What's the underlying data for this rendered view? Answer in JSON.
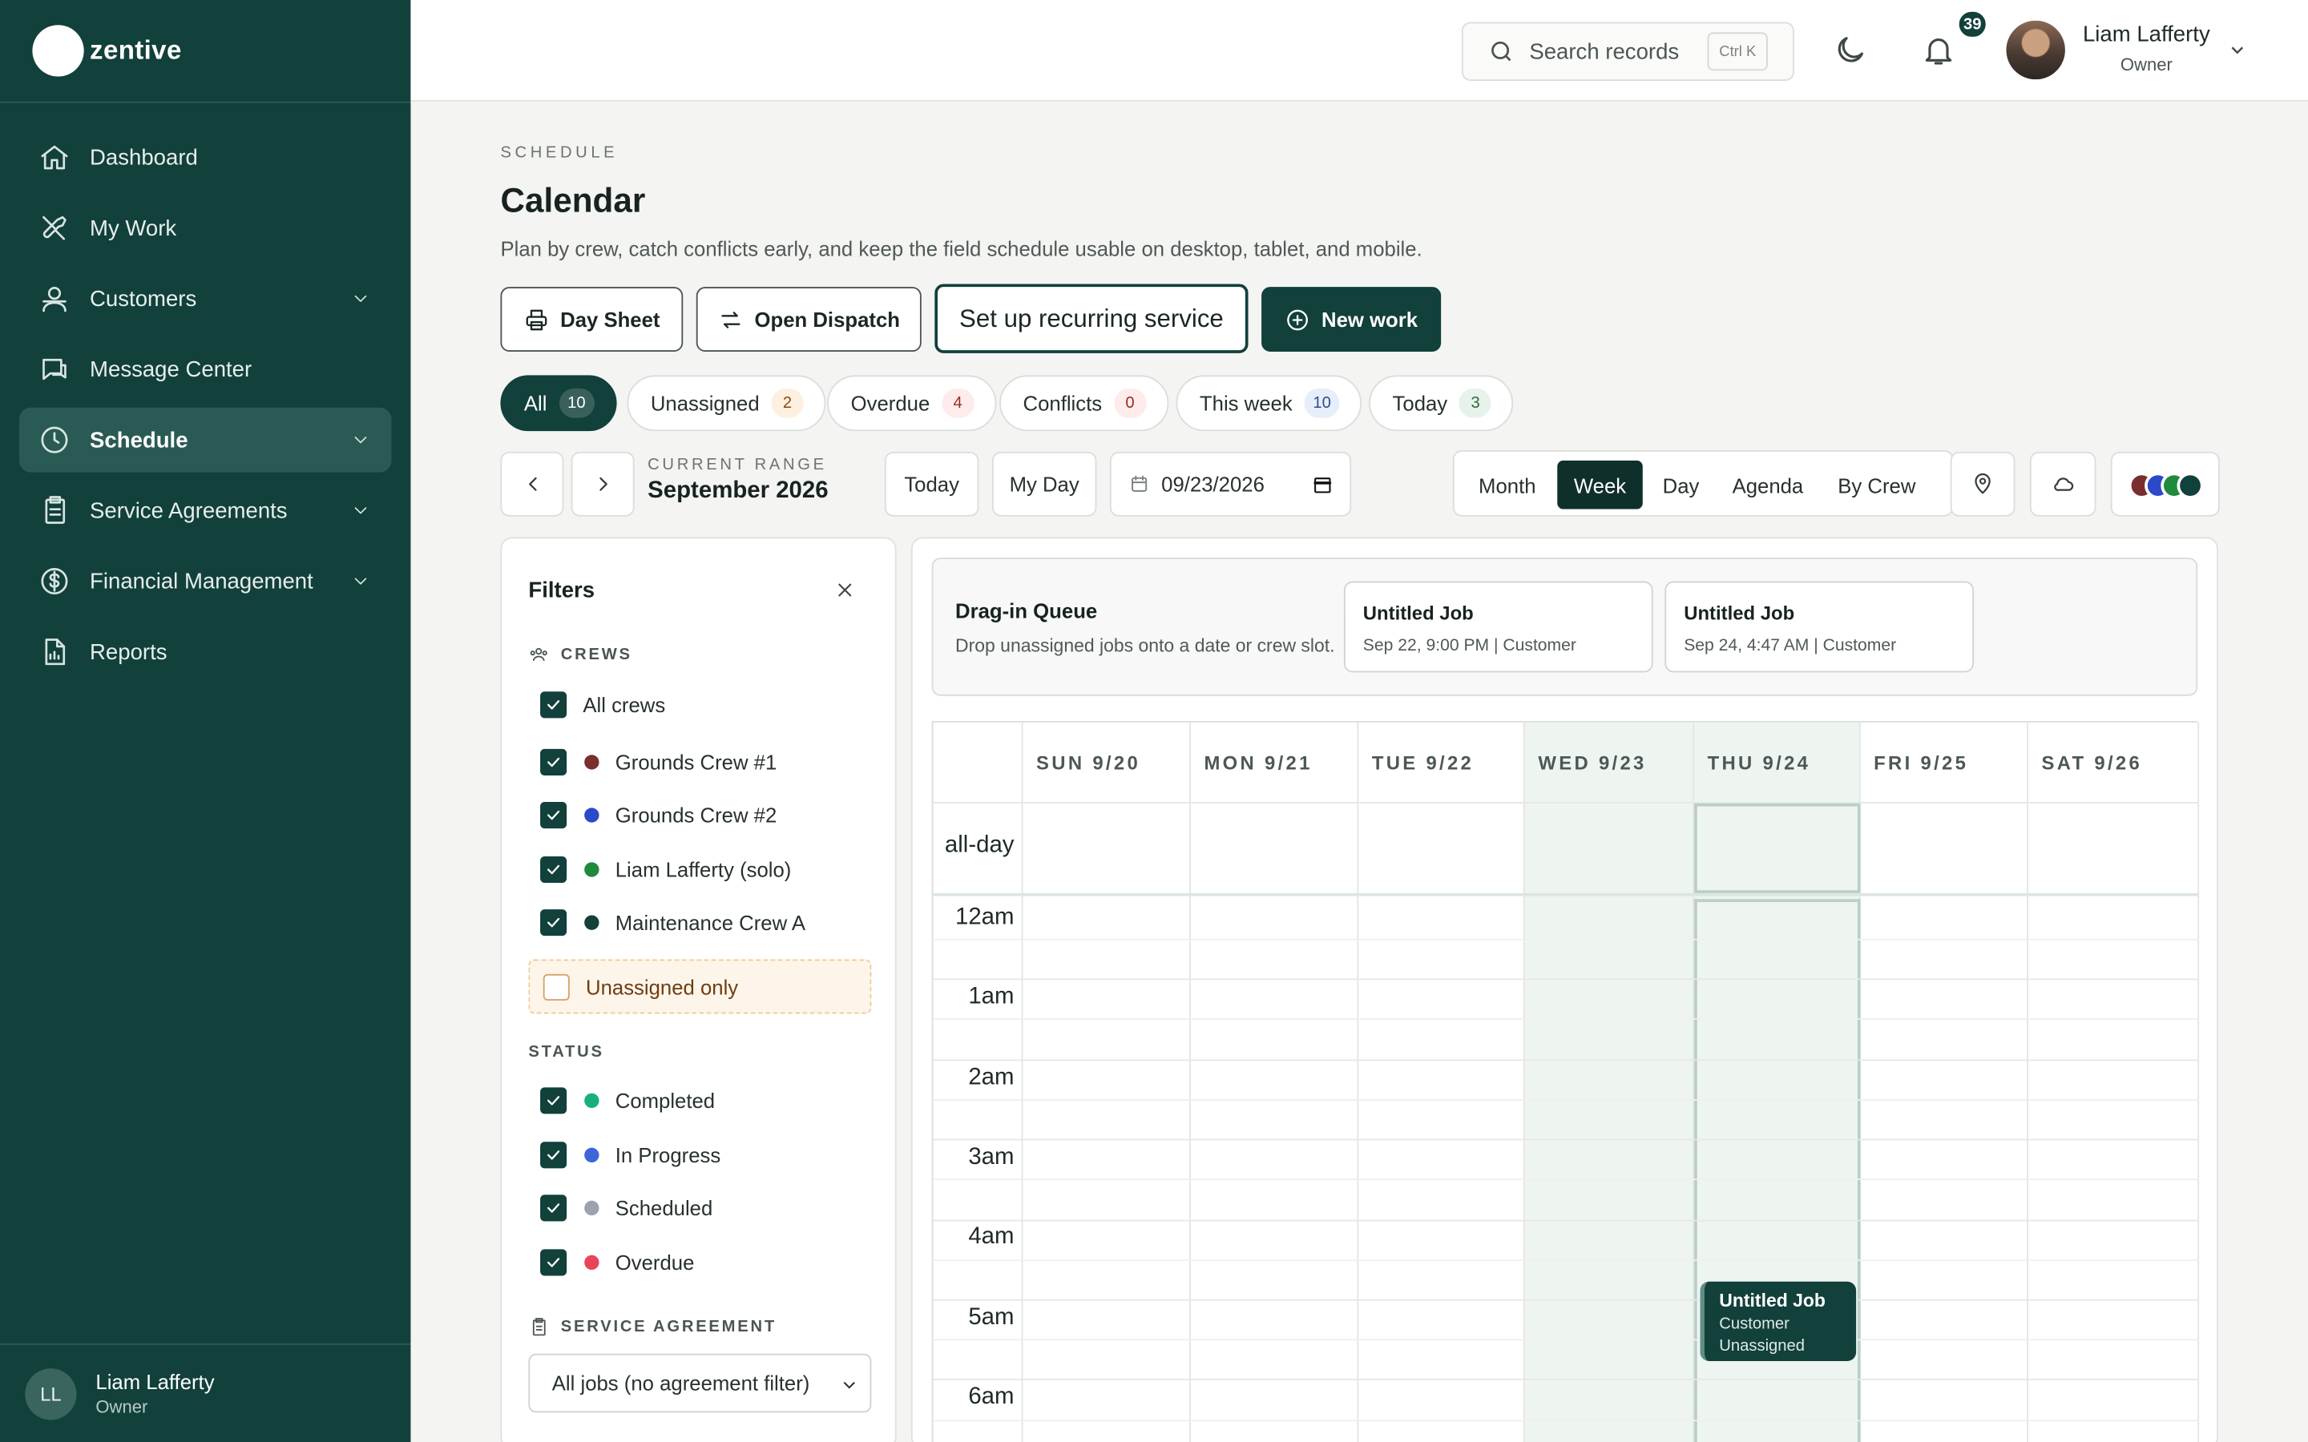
{
  "brand": {
    "name": "zentive"
  },
  "sidebar": {
    "items": [
      {
        "label": "Dashboard",
        "icon": "home-icon"
      },
      {
        "label": "My Work",
        "icon": "tools-icon"
      },
      {
        "label": "Customers",
        "icon": "users-icon",
        "expandable": true
      },
      {
        "label": "Message Center",
        "icon": "chat-icon"
      },
      {
        "label": "Schedule",
        "icon": "clock-icon",
        "expandable": true,
        "active": true
      },
      {
        "label": "Service Agreements",
        "icon": "clipboard-icon",
        "expandable": true
      },
      {
        "label": "Financial Management",
        "icon": "dollar-icon",
        "expandable": true
      },
      {
        "label": "Reports",
        "icon": "file-icon"
      }
    ],
    "footer": {
      "initials": "LL",
      "name": "Liam Lafferty",
      "role": "Owner"
    }
  },
  "header": {
    "search_placeholder": "Search records",
    "search_shortcut": "Ctrl K",
    "notifications_count": "39",
    "user": {
      "name": "Liam Lafferty",
      "role": "Owner"
    }
  },
  "page": {
    "eyebrow": "SCHEDULE",
    "title": "Calendar",
    "subtitle": "Plan by crew, catch conflicts early, and keep the field schedule usable on desktop, tablet, and mobile."
  },
  "actions": {
    "day_sheet": "Day Sheet",
    "open_dispatch": "Open Dispatch",
    "recurring": "Set up recurring service",
    "new_work": "New work"
  },
  "quick_filters": [
    {
      "label": "All",
      "count": "10"
    },
    {
      "label": "Unassigned",
      "count": "2"
    },
    {
      "label": "Overdue",
      "count": "4"
    },
    {
      "label": "Conflicts",
      "count": "0"
    },
    {
      "label": "This week",
      "count": "10"
    },
    {
      "label": "Today",
      "count": "3"
    }
  ],
  "toolbar": {
    "range_label": "CURRENT RANGE",
    "range_value": "September 2026",
    "today": "Today",
    "my_day": "My Day",
    "date_value": "09/23/2026",
    "views": [
      "Month",
      "Week",
      "Day",
      "Agenda",
      "By Crew"
    ],
    "active_view": "Week",
    "crew_colors": [
      "#7a2e2e",
      "#2b49c9",
      "#1f8a3c",
      "#12403b"
    ]
  },
  "filters": {
    "title": "Filters",
    "crews_heading": "CREWS",
    "all_crews": "All crews",
    "crews": [
      {
        "name": "Grounds Crew #1",
        "color": "#7a2e2e"
      },
      {
        "name": "Grounds Crew #2",
        "color": "#2b49c9"
      },
      {
        "name": "Liam Lafferty (solo)",
        "color": "#1f8a3c"
      },
      {
        "name": "Maintenance Crew A",
        "color": "#12403b"
      }
    ],
    "unassigned_only": "Unassigned only",
    "status_heading": "STATUS",
    "statuses": [
      {
        "name": "Completed",
        "color": "#18b07a"
      },
      {
        "name": "In Progress",
        "color": "#3d66d9"
      },
      {
        "name": "Scheduled",
        "color": "#9aa2ad"
      },
      {
        "name": "Overdue",
        "color": "#e8455b"
      }
    ],
    "agreement_heading": "SERVICE AGREEMENT",
    "agreement_value": "All jobs (no agreement filter)"
  },
  "queue": {
    "title": "Drag-in Queue",
    "subtitle": "Drop unassigned jobs onto a date or crew slot.",
    "cards": [
      {
        "title": "Untitled Job",
        "meta": "Sep 22, 9:00 PM | Customer"
      },
      {
        "title": "Untitled Job",
        "meta": "Sep 24, 4:47 AM | Customer"
      }
    ]
  },
  "calendar": {
    "days": [
      "SUN 9/20",
      "MON 9/21",
      "TUE 9/22",
      "WED 9/23",
      "THU 9/24",
      "FRI 9/25",
      "SAT 9/26"
    ],
    "allday_label": "all-day",
    "hours": [
      "12am",
      "1am",
      "2am",
      "3am",
      "4am",
      "5am",
      "6am"
    ],
    "event": {
      "title": "Untitled Job",
      "customer": "Customer",
      "status": "Unassigned"
    }
  }
}
